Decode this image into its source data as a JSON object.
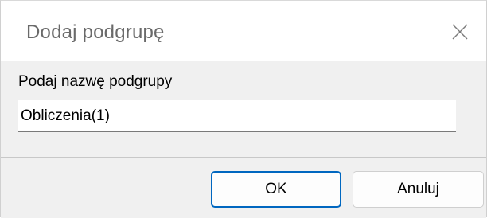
{
  "dialog": {
    "title": "Dodaj podgrupę",
    "close_icon": "close-icon",
    "prompt_label": "Podaj nazwę podgrupy",
    "input_value": "Obliczenia(1)",
    "ok_label": "OK",
    "cancel_label": "Anuluj"
  },
  "colors": {
    "content_background": "#f0f0f0",
    "title_background": "#ffffff",
    "default_button_border": "#0067c0"
  }
}
